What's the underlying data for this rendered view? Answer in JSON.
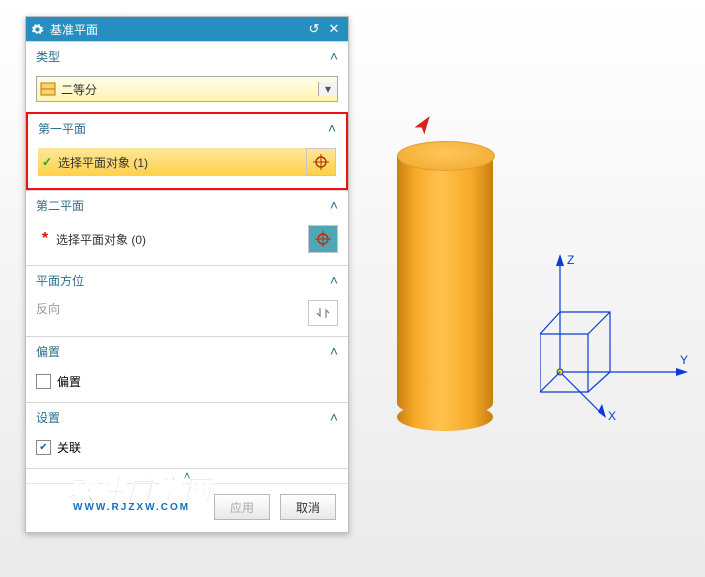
{
  "title": "基准平面",
  "sections": {
    "type": {
      "header": "类型",
      "combo_value": "二等分"
    },
    "plane1": {
      "header": "第一平面",
      "label": "选择平面对象 (1)"
    },
    "plane2": {
      "header": "第二平面",
      "label": "选择平面对象 (0)"
    },
    "orient": {
      "header": "平面方位",
      "reverse_label": "反向"
    },
    "offset": {
      "header": "偏置",
      "checkbox_label": "偏置"
    },
    "settings": {
      "header": "设置",
      "checkbox_label": "关联"
    }
  },
  "buttons": {
    "apply": "应用",
    "cancel": "取消"
  },
  "triad": {
    "x": "X",
    "y": "Y",
    "z": "Z"
  },
  "watermark": {
    "main": "软件自学网",
    "sub": "WWW.RJZXW.COM"
  },
  "icons": {
    "gear": "gear-icon",
    "undo": "↺",
    "close": "✕",
    "chevron_up": "˄",
    "dropdown": "▾",
    "check": "✓",
    "asterisk": "*",
    "crosshair": "⊕",
    "swap": "⇅"
  }
}
